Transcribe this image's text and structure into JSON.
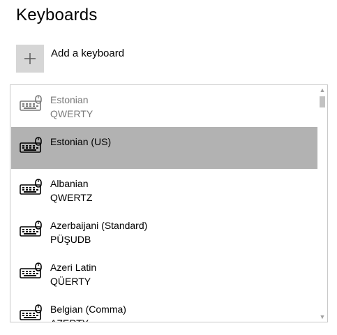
{
  "page": {
    "title": "Keyboards"
  },
  "add": {
    "label": "Add a keyboard",
    "icon": "plus-icon"
  },
  "keyboards": [
    {
      "name": "Estonian",
      "layout": "QWERTY",
      "state": "dim",
      "icon": "keyboard-icon"
    },
    {
      "name": "Estonian (US)",
      "layout": "",
      "state": "selected",
      "icon": "keyboard-icon"
    },
    {
      "name": "Albanian",
      "layout": "QWERTZ",
      "state": "normal",
      "icon": "keyboard-icon"
    },
    {
      "name": "Azerbaijani (Standard)",
      "layout": "PÜŞUDB",
      "state": "normal",
      "icon": "keyboard-icon"
    },
    {
      "name": "Azeri Latin",
      "layout": "QÜERTY",
      "state": "normal",
      "icon": "keyboard-icon"
    },
    {
      "name": "Belgian (Comma)",
      "layout": "AZERTY",
      "state": "normal",
      "icon": "keyboard-icon"
    }
  ],
  "scroll": {
    "position": 0.0,
    "visible_fraction": 0.05
  },
  "colors": {
    "selected_bg": "#b2b2b2",
    "add_tile": "#d6d6d6",
    "border": "#c8c8c8",
    "dim_text": "#7a7a7a"
  }
}
